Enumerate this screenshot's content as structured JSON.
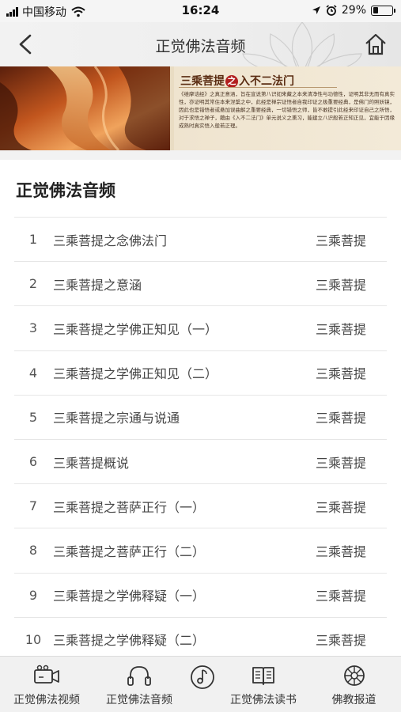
{
  "status_bar": {
    "carrier": "中国移动",
    "time": "16:24",
    "battery": "29%"
  },
  "nav": {
    "title": "正觉佛法音频"
  },
  "banner": {
    "heading_pre": "三乘菩提",
    "heading_mid": "之",
    "heading_post": "入不二法门",
    "body": "《维摩诘经》之真正意涵，旨在宣说第八识如来藏之本来清净性与功德性，证明其非无而有真实性，亦证明其常住本来涅槃之中，此经是禅宗证悟者自我印证之极重要经典，是佛门的照妖镜，因此也是错悟者或悬加误曲解之重要经典，一切错悟之师，皆不敢提引此经来印证自己之所悟，对于求悟之禅子，藉由《入不二法门》单元说义之熏习，能建立八识般若正知正见，宜能于因缘成熟时真实悟入般若正理。"
  },
  "section": {
    "title": "正觉佛法音频"
  },
  "list": [
    {
      "num": "1",
      "title": "三乘菩提之念佛法门",
      "category": "三乘菩提"
    },
    {
      "num": "2",
      "title": "三乘菩提之意涵",
      "category": "三乘菩提"
    },
    {
      "num": "3",
      "title": "三乘菩提之学佛正知见（一）",
      "category": "三乘菩提"
    },
    {
      "num": "4",
      "title": "三乘菩提之学佛正知见（二）",
      "category": "三乘菩提"
    },
    {
      "num": "5",
      "title": "三乘菩提之宗通与说通",
      "category": "三乘菩提"
    },
    {
      "num": "6",
      "title": "三乘菩提概说",
      "category": "三乘菩提"
    },
    {
      "num": "7",
      "title": "三乘菩提之菩萨正行（一）",
      "category": "三乘菩提"
    },
    {
      "num": "8",
      "title": "三乘菩提之菩萨正行（二）",
      "category": "三乘菩提"
    },
    {
      "num": "9",
      "title": "三乘菩提之学佛释疑（一）",
      "category": "三乘菩提"
    },
    {
      "num": "10",
      "title": "三乘菩提之学佛释疑（二）",
      "category": "三乘菩提"
    }
  ],
  "tabs": [
    {
      "label": "正觉佛法视频",
      "icon": "video-camera-icon"
    },
    {
      "label": "正觉佛法音频",
      "icon": "headphones-icon"
    },
    {
      "label": "",
      "icon": "music-disc-icon"
    },
    {
      "label": "正觉佛法读书",
      "icon": "open-book-icon"
    },
    {
      "label": "佛教报道",
      "icon": "dharma-wheel-icon"
    }
  ],
  "colors": {
    "nav_bg": "#eeeeee",
    "tab_bg": "#f1f1f1",
    "banner_accent": "#b21f1f"
  }
}
